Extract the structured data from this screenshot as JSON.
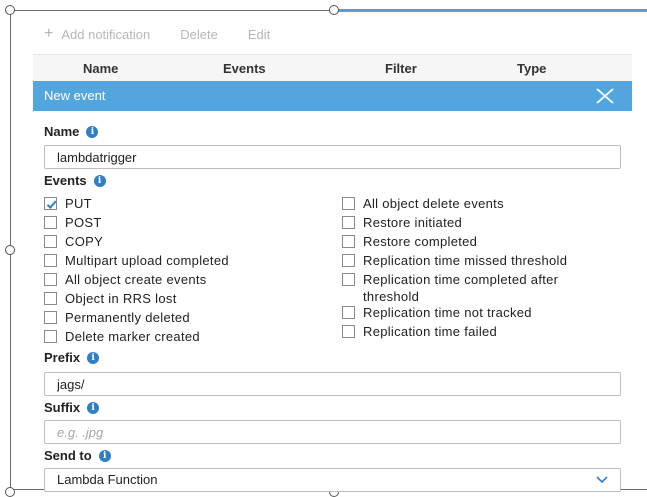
{
  "toolbar": {
    "add_label": "Add notification",
    "delete_label": "Delete",
    "edit_label": "Edit"
  },
  "table_columns": [
    "Name",
    "Events",
    "Filter",
    "Type"
  ],
  "dialog": {
    "title": "New event",
    "name_label": "Name",
    "name_value": "lambdatrigger",
    "events_label": "Events",
    "events_left": [
      {
        "label": "PUT",
        "checked": true
      },
      {
        "label": "POST",
        "checked": false
      },
      {
        "label": "COPY",
        "checked": false
      },
      {
        "label": "Multipart upload completed",
        "checked": false
      },
      {
        "label": "All object create events",
        "checked": false
      },
      {
        "label": "Object in RRS lost",
        "checked": false
      },
      {
        "label": "Permanently deleted",
        "checked": false
      },
      {
        "label": "Delete marker created",
        "checked": false
      }
    ],
    "events_right": [
      {
        "label": "All object delete events",
        "checked": false
      },
      {
        "label": "Restore initiated",
        "checked": false
      },
      {
        "label": "Restore completed",
        "checked": false
      },
      {
        "label": "Replication time missed threshold",
        "checked": false
      },
      {
        "label": "Replication time completed after threshold",
        "checked": false
      },
      {
        "label": "Replication time not tracked",
        "checked": false
      },
      {
        "label": "Replication time failed",
        "checked": false
      }
    ],
    "prefix_label": "Prefix",
    "prefix_value": "jags/",
    "suffix_label": "Suffix",
    "suffix_placeholder": "e.g. .jpg",
    "send_to_label": "Send to",
    "send_to_value": "Lambda Function"
  },
  "colors": {
    "titlebar": "#53a6dd",
    "info_icon": "#2f7fc4",
    "check": "#2f7fc4"
  }
}
